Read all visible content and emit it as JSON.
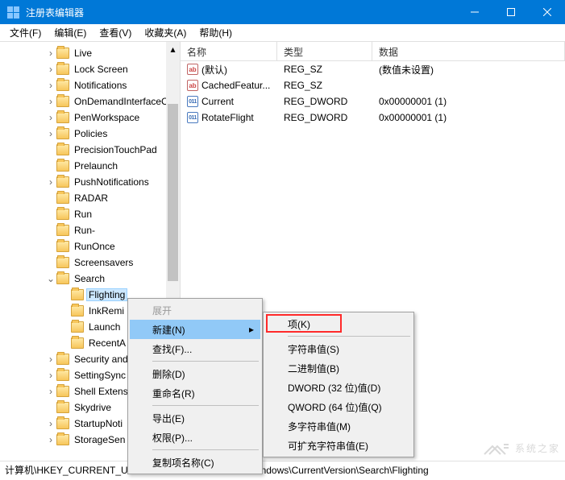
{
  "window": {
    "title": "注册表编辑器"
  },
  "menu": {
    "file": "文件(F)",
    "edit": "编辑(E)",
    "view": "查看(V)",
    "favorites": "收藏夹(A)",
    "help": "帮助(H)"
  },
  "tree": [
    {
      "depth": 2,
      "tw": "›",
      "label": "Live"
    },
    {
      "depth": 2,
      "tw": "›",
      "label": "Lock Screen"
    },
    {
      "depth": 2,
      "tw": "›",
      "label": "Notifications"
    },
    {
      "depth": 2,
      "tw": "›",
      "label": "OnDemandInterfaceC"
    },
    {
      "depth": 2,
      "tw": "›",
      "label": "PenWorkspace"
    },
    {
      "depth": 2,
      "tw": "›",
      "label": "Policies"
    },
    {
      "depth": 2,
      "tw": "",
      "label": "PrecisionTouchPad"
    },
    {
      "depth": 2,
      "tw": "",
      "label": "Prelaunch"
    },
    {
      "depth": 2,
      "tw": "›",
      "label": "PushNotifications"
    },
    {
      "depth": 2,
      "tw": "",
      "label": "RADAR"
    },
    {
      "depth": 2,
      "tw": "",
      "label": "Run"
    },
    {
      "depth": 2,
      "tw": "",
      "label": "Run-"
    },
    {
      "depth": 2,
      "tw": "",
      "label": "RunOnce"
    },
    {
      "depth": 2,
      "tw": "",
      "label": "Screensavers"
    },
    {
      "depth": 2,
      "tw": "v",
      "label": "Search"
    },
    {
      "depth": 3,
      "tw": "",
      "label": "Flighting",
      "sel": true
    },
    {
      "depth": 3,
      "tw": "",
      "label": "InkRemi"
    },
    {
      "depth": 3,
      "tw": "",
      "label": "Launch"
    },
    {
      "depth": 3,
      "tw": "",
      "label": "RecentA"
    },
    {
      "depth": 2,
      "tw": "›",
      "label": "Security and"
    },
    {
      "depth": 2,
      "tw": "›",
      "label": "SettingSync"
    },
    {
      "depth": 2,
      "tw": "›",
      "label": "Shell Extens"
    },
    {
      "depth": 2,
      "tw": "",
      "label": "Skydrive"
    },
    {
      "depth": 2,
      "tw": "›",
      "label": "StartupNoti"
    },
    {
      "depth": 2,
      "tw": "›",
      "label": "StorageSen"
    }
  ],
  "list": {
    "cols": {
      "name": "名称",
      "type": "类型",
      "data": "数据"
    },
    "rows": [
      {
        "icon": "str",
        "name": "(默认)",
        "type": "REG_SZ",
        "data": "(数值未设置)"
      },
      {
        "icon": "str",
        "name": "CachedFeatur...",
        "type": "REG_SZ",
        "data": ""
      },
      {
        "icon": "dw",
        "name": "Current",
        "type": "REG_DWORD",
        "data": "0x00000001 (1)"
      },
      {
        "icon": "dw",
        "name": "RotateFlight",
        "type": "REG_DWORD",
        "data": "0x00000001 (1)"
      }
    ]
  },
  "context1": {
    "expand": "展开",
    "new": "新建(N)",
    "find": "查找(F)...",
    "delete": "删除(D)",
    "rename": "重命名(R)",
    "export": "导出(E)",
    "permissions": "权限(P)...",
    "copyKeyName": "复制项名称(C)"
  },
  "context2": {
    "key": "项(K)",
    "string": "字符串值(S)",
    "binary": "二进制值(B)",
    "dword": "DWORD (32 位)值(D)",
    "qword": "QWORD (64 位)值(Q)",
    "multi": "多字符串值(M)",
    "expand": "可扩充字符串值(E)"
  },
  "status": "计算机\\HKEY_CURRENT_USER\\SOFTWARE\\Microsoft\\Windows\\CurrentVersion\\Search\\Flighting",
  "watermark": "系统之家"
}
